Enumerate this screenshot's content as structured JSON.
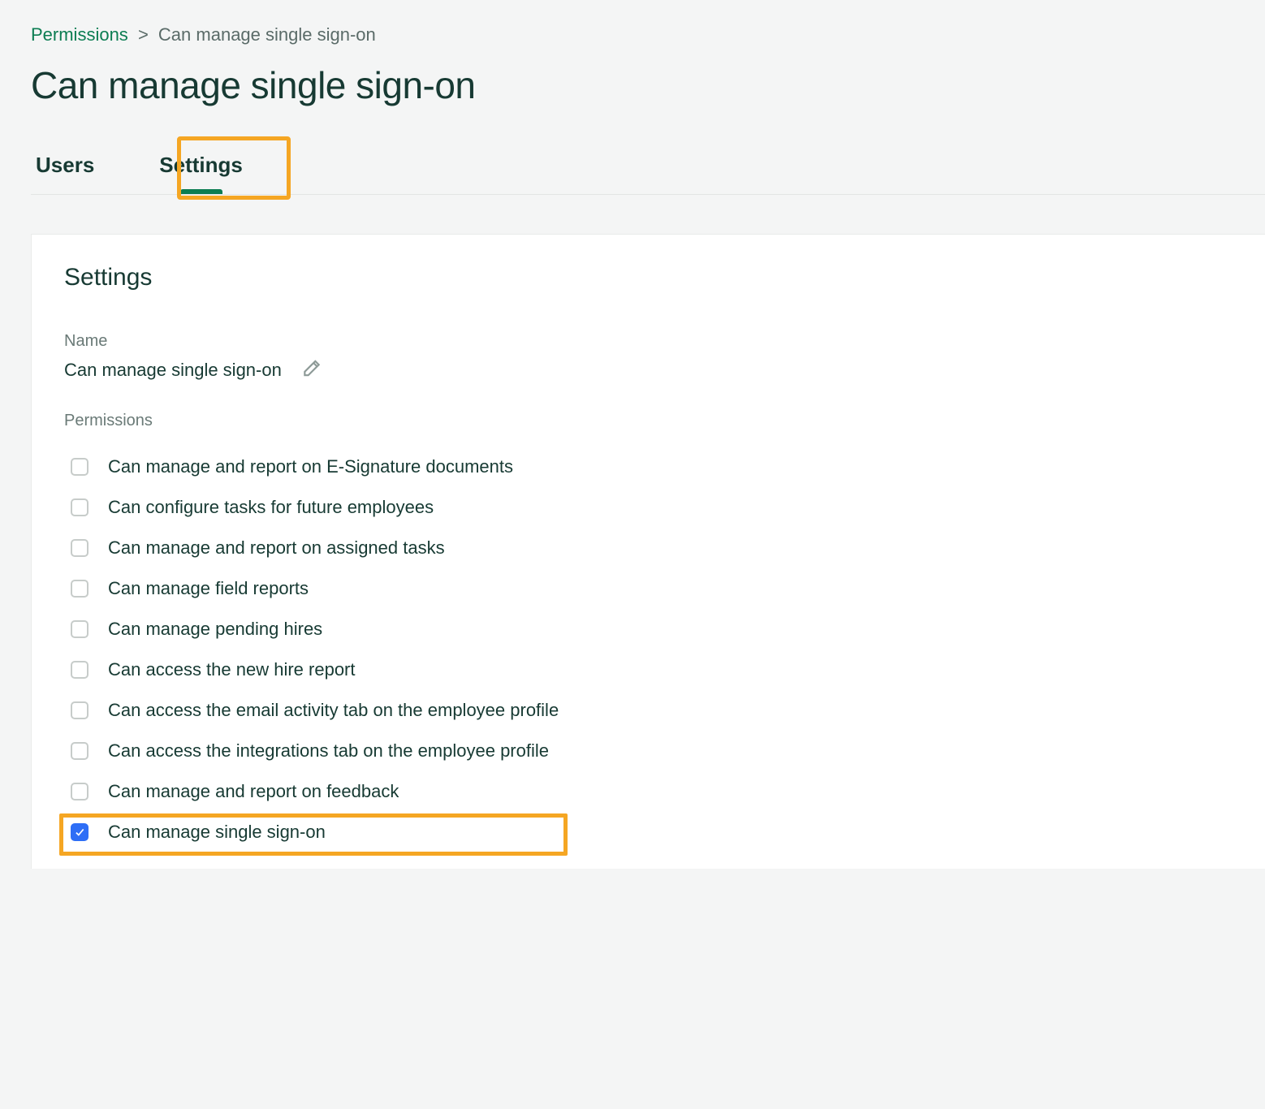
{
  "breadcrumb": {
    "root": "Permissions",
    "current": "Can manage single sign-on"
  },
  "page_title": "Can manage single sign-on",
  "tabs": [
    {
      "label": "Users",
      "active": false
    },
    {
      "label": "Settings",
      "active": true
    }
  ],
  "panel": {
    "title": "Settings",
    "name_label": "Name",
    "name_value": "Can manage single sign-on",
    "permissions_label": "Permissions",
    "permissions": [
      {
        "label": "Can manage and report on E-Signature documents",
        "checked": false
      },
      {
        "label": "Can configure tasks for future employees",
        "checked": false
      },
      {
        "label": "Can manage and report on assigned tasks",
        "checked": false
      },
      {
        "label": "Can manage field reports",
        "checked": false
      },
      {
        "label": "Can manage pending hires",
        "checked": false
      },
      {
        "label": "Can access the new hire report",
        "checked": false
      },
      {
        "label": "Can access the email activity tab on the employee profile",
        "checked": false
      },
      {
        "label": "Can access the integrations tab on the employee profile",
        "checked": false
      },
      {
        "label": "Can manage and report on feedback",
        "checked": false
      },
      {
        "label": "Can manage single sign-on",
        "checked": true,
        "highlighted": true
      }
    ]
  }
}
